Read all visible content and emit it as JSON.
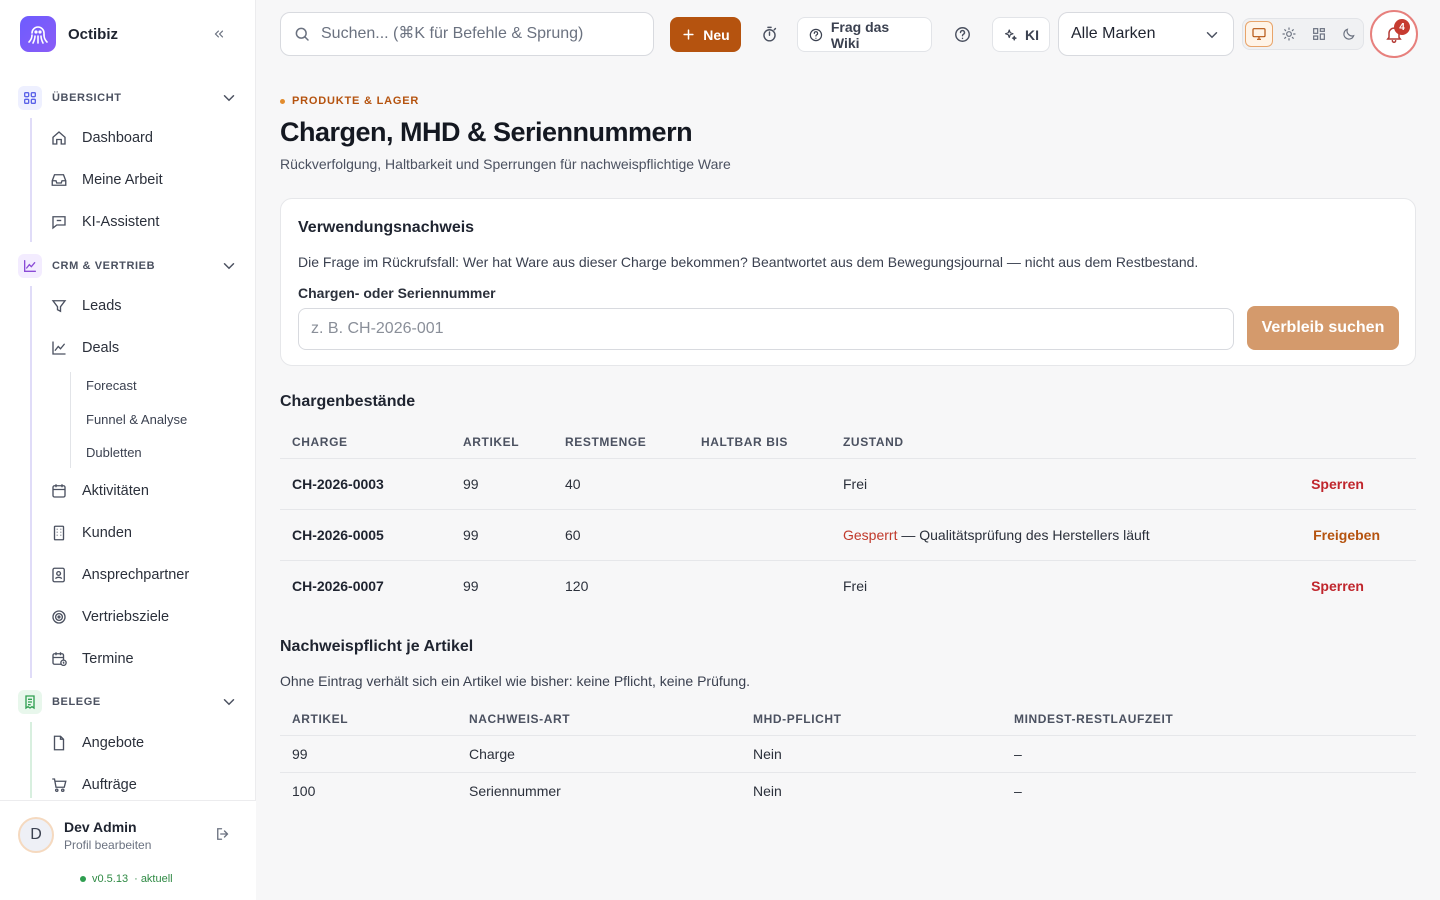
{
  "app": {
    "name": "Octibiz"
  },
  "sidebar": {
    "groups": [
      {
        "label": "ÜBERSICHT",
        "items": [
          "Dashboard",
          "Meine Arbeit",
          "KI-Assistent"
        ]
      },
      {
        "label": "CRM & VERTRIEB",
        "items": [
          "Leads",
          "Deals",
          "Aktivitäten",
          "Kunden",
          "Ansprechpartner",
          "Vertriebsziele",
          "Termine"
        ],
        "sub_items": [
          "Forecast",
          "Funnel & Analyse",
          "Dubletten"
        ]
      },
      {
        "label": "BELEGE",
        "items": [
          "Angebote",
          "Aufträge"
        ]
      }
    ],
    "user": {
      "initial": "D",
      "name": "Dev Admin",
      "sub": "Profil bearbeiten"
    },
    "version": "v0.5.13",
    "version_status": "· aktuell"
  },
  "topbar": {
    "search_placeholder": "Suchen... (⌘K für Befehle & Sprung)",
    "new_label": "Neu",
    "wiki_label": "Frag das Wiki",
    "ai_label": "KI",
    "brand_select": "Alle Marken",
    "notifications": "4"
  },
  "page": {
    "eyebrow": "PRODUKTE & LAGER",
    "title": "Chargen, MHD & Seriennummern",
    "subtitle": "Rückverfolgung, Haltbarkeit und Sperrungen für nachweispflichtige Ware"
  },
  "trace_card": {
    "title": "Verwendungsnachweis",
    "description": "Die Frage im Rückrufsfall: Wer hat Ware aus dieser Charge bekommen? Beantwortet aus dem Bewegungsjournal — nicht aus dem Restbestand.",
    "field_label": "Chargen- oder Seriennummer",
    "field_placeholder": "z. B. CH-2026-001",
    "button": "Verbleib suchen"
  },
  "batches": {
    "title": "Chargenbestände",
    "headers": [
      "CHARGE",
      "ARTIKEL",
      "RESTMENGE",
      "HALTBAR BIS",
      "ZUSTAND"
    ],
    "rows": [
      {
        "charge": "CH-2026-0003",
        "artikel": "99",
        "restmenge": "40",
        "haltbar": "",
        "status": "Frei",
        "status_note": "",
        "action": "Sperren"
      },
      {
        "charge": "CH-2026-0005",
        "artikel": "99",
        "restmenge": "60",
        "haltbar": "",
        "status": "Gesperrt",
        "status_note": "— Qualitätsprüfung des Herstellers läuft",
        "action": "Freigeben"
      },
      {
        "charge": "CH-2026-0007",
        "artikel": "99",
        "restmenge": "120",
        "haltbar": "",
        "status": "Frei",
        "status_note": "",
        "action": "Sperren"
      }
    ]
  },
  "obligation": {
    "title": "Nachweispflicht je Artikel",
    "description": "Ohne Eintrag verhält sich ein Artikel wie bisher: keine Pflicht, keine Prüfung.",
    "headers": [
      "ARTIKEL",
      "NACHWEIS-ART",
      "MHD-PFLICHT",
      "MINDEST-RESTLAUFZEIT"
    ],
    "rows": [
      {
        "artikel": "99",
        "art": "Charge",
        "mhd": "Nein",
        "rest": "–"
      },
      {
        "artikel": "100",
        "art": "Seriennummer",
        "mhd": "Nein",
        "rest": "–"
      }
    ]
  },
  "colors": {
    "accent": "#b5530f",
    "danger": "#c0262d",
    "brand": "#6d5cff"
  }
}
